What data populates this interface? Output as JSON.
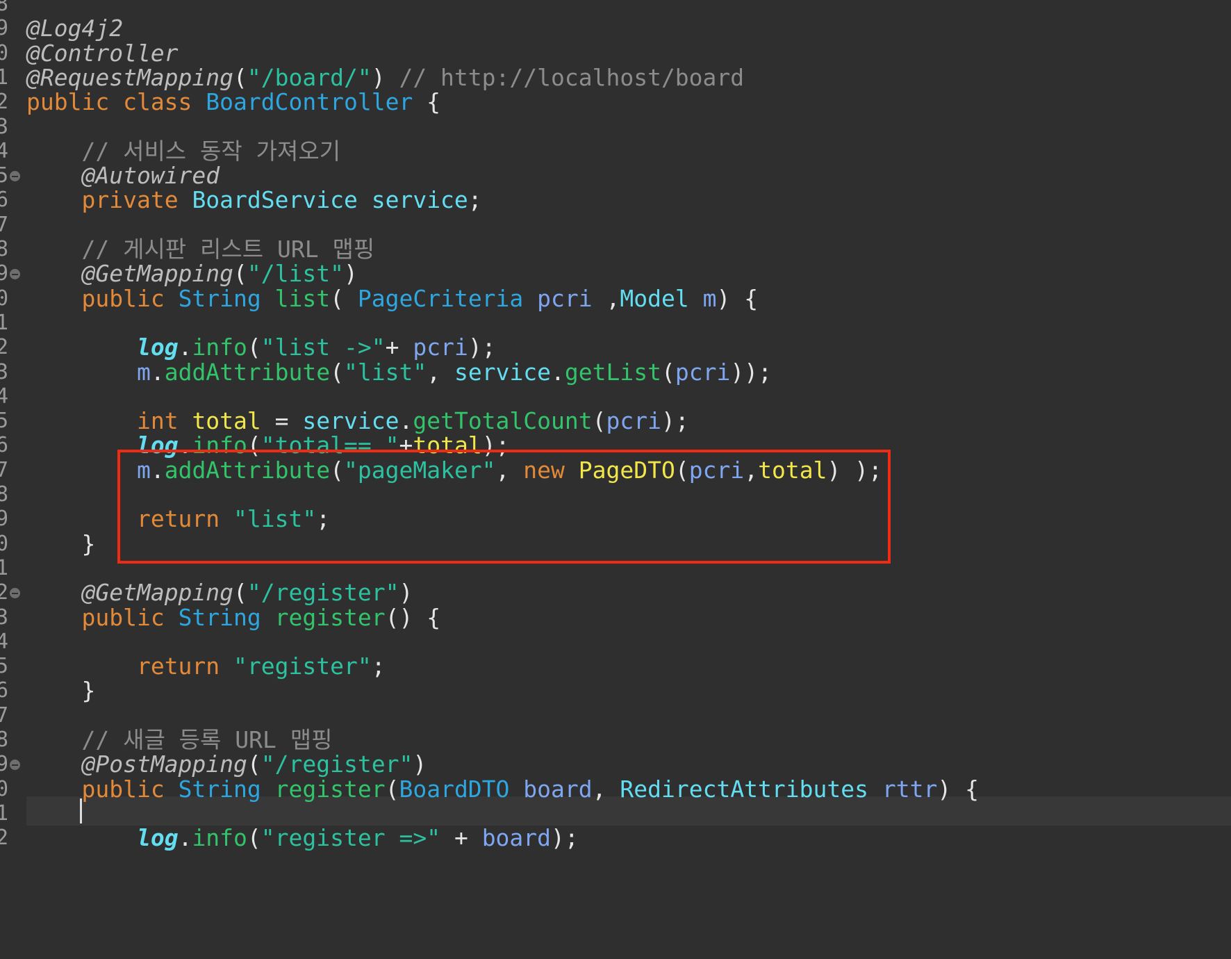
{
  "colors": {
    "background": "#2f2f2f",
    "annotation": "#bdbdbd",
    "keyword": "#e28a3a",
    "type": "#2ea6df",
    "string": "#2cc2a0",
    "comment": "#8c8c8c",
    "method": "#33c46b",
    "field": "#63ddf0",
    "local": "#f1e64a",
    "param": "#7fa6f0",
    "plain": "#e6e6e6",
    "highlight_box": "#ef2b13"
  },
  "editor": {
    "lines": [
      {
        "num": "8",
        "fold": false,
        "tokens": []
      },
      {
        "num": "9",
        "fold": false,
        "tokens": [
          {
            "t": "@Log4j2",
            "c": "ann"
          }
        ]
      },
      {
        "num": "0",
        "fold": false,
        "tokens": [
          {
            "t": "@Controller",
            "c": "ann"
          }
        ]
      },
      {
        "num": "1",
        "fold": false,
        "tokens": [
          {
            "t": "@RequestMapping",
            "c": "ann"
          },
          {
            "t": "(",
            "c": "plain"
          },
          {
            "t": "\"/board/\"",
            "c": "str"
          },
          {
            "t": ") ",
            "c": "plain"
          },
          {
            "t": "// http://localhost/board",
            "c": "comment"
          }
        ]
      },
      {
        "num": "2",
        "fold": false,
        "tokens": [
          {
            "t": "public ",
            "c": "kw"
          },
          {
            "t": "class ",
            "c": "kw"
          },
          {
            "t": "BoardController",
            "c": "type"
          },
          {
            "t": " {",
            "c": "plain"
          }
        ]
      },
      {
        "num": "3",
        "fold": false,
        "tokens": []
      },
      {
        "num": "4",
        "fold": false,
        "tokens": [
          {
            "t": "    ",
            "c": "plain"
          },
          {
            "t": "// 서비스 동작 가져오기",
            "c": "comment"
          }
        ]
      },
      {
        "num": "5",
        "fold": true,
        "tokens": [
          {
            "t": "    ",
            "c": "plain"
          },
          {
            "t": "@Autowired",
            "c": "ann"
          }
        ]
      },
      {
        "num": "6",
        "fold": false,
        "tokens": [
          {
            "t": "    ",
            "c": "plain"
          },
          {
            "t": "private ",
            "c": "kw"
          },
          {
            "t": "BoardService ",
            "c": "field"
          },
          {
            "t": "service",
            "c": "field"
          },
          {
            "t": ";",
            "c": "plain"
          }
        ]
      },
      {
        "num": "7",
        "fold": false,
        "tokens": []
      },
      {
        "num": "8",
        "fold": false,
        "tokens": [
          {
            "t": "    ",
            "c": "plain"
          },
          {
            "t": "// 게시판 리스트 URL 맵핑",
            "c": "comment"
          }
        ]
      },
      {
        "num": "9",
        "fold": true,
        "tokens": [
          {
            "t": "    ",
            "c": "plain"
          },
          {
            "t": "@GetMapping",
            "c": "ann"
          },
          {
            "t": "(",
            "c": "plain"
          },
          {
            "t": "\"/list\"",
            "c": "str"
          },
          {
            "t": ")",
            "c": "plain"
          }
        ]
      },
      {
        "num": "0",
        "fold": false,
        "tokens": [
          {
            "t": "    ",
            "c": "plain"
          },
          {
            "t": "public ",
            "c": "kw"
          },
          {
            "t": "String ",
            "c": "type"
          },
          {
            "t": "list",
            "c": "method"
          },
          {
            "t": "( ",
            "c": "plain"
          },
          {
            "t": "PageCriteria ",
            "c": "type"
          },
          {
            "t": "pcri",
            "c": "param"
          },
          {
            "t": " ,",
            "c": "plain"
          },
          {
            "t": "Model ",
            "c": "field"
          },
          {
            "t": "m",
            "c": "param"
          },
          {
            "t": ") {",
            "c": "plain"
          }
        ]
      },
      {
        "num": "1",
        "fold": false,
        "tokens": []
      },
      {
        "num": "2",
        "fold": false,
        "tokens": [
          {
            "t": "        ",
            "c": "plain"
          },
          {
            "t": "log",
            "c": "logf"
          },
          {
            "t": ".",
            "c": "plain"
          },
          {
            "t": "info",
            "c": "method"
          },
          {
            "t": "(",
            "c": "plain"
          },
          {
            "t": "\"list ->\"",
            "c": "str"
          },
          {
            "t": "+ ",
            "c": "plain"
          },
          {
            "t": "pcri",
            "c": "param"
          },
          {
            "t": ");",
            "c": "plain"
          }
        ]
      },
      {
        "num": "3",
        "fold": false,
        "tokens": [
          {
            "t": "        ",
            "c": "plain"
          },
          {
            "t": "m",
            "c": "param"
          },
          {
            "t": ".",
            "c": "plain"
          },
          {
            "t": "addAttribute",
            "c": "method"
          },
          {
            "t": "(",
            "c": "plain"
          },
          {
            "t": "\"list\"",
            "c": "str"
          },
          {
            "t": ", ",
            "c": "plain"
          },
          {
            "t": "service",
            "c": "field"
          },
          {
            "t": ".",
            "c": "plain"
          },
          {
            "t": "getList",
            "c": "method"
          },
          {
            "t": "(",
            "c": "plain"
          },
          {
            "t": "pcri",
            "c": "param"
          },
          {
            "t": "));",
            "c": "plain"
          }
        ]
      },
      {
        "num": "4",
        "fold": false,
        "tokens": []
      },
      {
        "num": "5",
        "fold": false,
        "tokens": [
          {
            "t": "        ",
            "c": "plain"
          },
          {
            "t": "int ",
            "c": "kw"
          },
          {
            "t": "total",
            "c": "local"
          },
          {
            "t": " = ",
            "c": "plain"
          },
          {
            "t": "service",
            "c": "field"
          },
          {
            "t": ".",
            "c": "plain"
          },
          {
            "t": "getTotalCount",
            "c": "method"
          },
          {
            "t": "(",
            "c": "plain"
          },
          {
            "t": "pcri",
            "c": "param"
          },
          {
            "t": ");",
            "c": "plain"
          }
        ]
      },
      {
        "num": "6",
        "fold": false,
        "tokens": [
          {
            "t": "        ",
            "c": "plain"
          },
          {
            "t": "log",
            "c": "logf"
          },
          {
            "t": ".",
            "c": "plain"
          },
          {
            "t": "info",
            "c": "method"
          },
          {
            "t": "(",
            "c": "plain"
          },
          {
            "t": "\"total== \"",
            "c": "str"
          },
          {
            "t": "+",
            "c": "plain"
          },
          {
            "t": "total",
            "c": "local"
          },
          {
            "t": ");",
            "c": "plain"
          }
        ]
      },
      {
        "num": "7",
        "fold": false,
        "tokens": [
          {
            "t": "        ",
            "c": "plain"
          },
          {
            "t": "m",
            "c": "param"
          },
          {
            "t": ".",
            "c": "plain"
          },
          {
            "t": "addAttribute",
            "c": "method"
          },
          {
            "t": "(",
            "c": "plain"
          },
          {
            "t": "\"pageMaker\"",
            "c": "str"
          },
          {
            "t": ", ",
            "c": "plain"
          },
          {
            "t": "new ",
            "c": "kw"
          },
          {
            "t": "PageDTO",
            "c": "ctor"
          },
          {
            "t": "(",
            "c": "plain"
          },
          {
            "t": "pcri",
            "c": "param"
          },
          {
            "t": ",",
            "c": "plain"
          },
          {
            "t": "total",
            "c": "local"
          },
          {
            "t": ") );",
            "c": "plain"
          }
        ]
      },
      {
        "num": "8",
        "fold": false,
        "tokens": []
      },
      {
        "num": "9",
        "fold": false,
        "tokens": [
          {
            "t": "        ",
            "c": "plain"
          },
          {
            "t": "return ",
            "c": "kw"
          },
          {
            "t": "\"list\"",
            "c": "str"
          },
          {
            "t": ";",
            "c": "plain"
          }
        ]
      },
      {
        "num": "0",
        "fold": false,
        "tokens": [
          {
            "t": "    }",
            "c": "plain"
          }
        ]
      },
      {
        "num": "1",
        "fold": false,
        "tokens": []
      },
      {
        "num": "2",
        "fold": true,
        "tokens": [
          {
            "t": "    ",
            "c": "plain"
          },
          {
            "t": "@GetMapping",
            "c": "ann"
          },
          {
            "t": "(",
            "c": "plain"
          },
          {
            "t": "\"/register\"",
            "c": "str"
          },
          {
            "t": ")",
            "c": "plain"
          }
        ]
      },
      {
        "num": "3",
        "fold": false,
        "tokens": [
          {
            "t": "    ",
            "c": "plain"
          },
          {
            "t": "public ",
            "c": "kw"
          },
          {
            "t": "String ",
            "c": "type"
          },
          {
            "t": "register",
            "c": "method"
          },
          {
            "t": "() {",
            "c": "plain"
          }
        ]
      },
      {
        "num": "4",
        "fold": false,
        "tokens": []
      },
      {
        "num": "5",
        "fold": false,
        "tokens": [
          {
            "t": "        ",
            "c": "plain"
          },
          {
            "t": "return ",
            "c": "kw"
          },
          {
            "t": "\"register\"",
            "c": "str"
          },
          {
            "t": ";",
            "c": "plain"
          }
        ]
      },
      {
        "num": "6",
        "fold": false,
        "tokens": [
          {
            "t": "    }",
            "c": "plain"
          }
        ]
      },
      {
        "num": "7",
        "fold": false,
        "tokens": []
      },
      {
        "num": "8",
        "fold": false,
        "tokens": [
          {
            "t": "    ",
            "c": "plain"
          },
          {
            "t": "// 새글 등록 URL 맵핑",
            "c": "comment"
          }
        ]
      },
      {
        "num": "9",
        "fold": true,
        "tokens": [
          {
            "t": "    ",
            "c": "plain"
          },
          {
            "t": "@PostMapping",
            "c": "ann"
          },
          {
            "t": "(",
            "c": "plain"
          },
          {
            "t": "\"/register\"",
            "c": "str"
          },
          {
            "t": ")",
            "c": "plain"
          }
        ]
      },
      {
        "num": "0",
        "fold": false,
        "tokens": [
          {
            "t": "    ",
            "c": "plain"
          },
          {
            "t": "public ",
            "c": "kw"
          },
          {
            "t": "String ",
            "c": "type"
          },
          {
            "t": "register",
            "c": "method"
          },
          {
            "t": "(",
            "c": "plain"
          },
          {
            "t": "BoardDTO ",
            "c": "type"
          },
          {
            "t": "board",
            "c": "param"
          },
          {
            "t": ", ",
            "c": "plain"
          },
          {
            "t": "RedirectAttributes ",
            "c": "field"
          },
          {
            "t": "rttr",
            "c": "param"
          },
          {
            "t": ") {",
            "c": "plain"
          }
        ]
      },
      {
        "num": "1",
        "fold": false,
        "tokens": []
      },
      {
        "num": "2",
        "fold": false,
        "tokens": [
          {
            "t": "        ",
            "c": "plain"
          },
          {
            "t": "log",
            "c": "logf"
          },
          {
            "t": ".",
            "c": "plain"
          },
          {
            "t": "info",
            "c": "method"
          },
          {
            "t": "(",
            "c": "plain"
          },
          {
            "t": "\"register =>\"",
            "c": "str"
          },
          {
            "t": " + ",
            "c": "plain"
          },
          {
            "t": "board",
            "c": "param"
          },
          {
            "t": ");",
            "c": "plain"
          }
        ]
      }
    ]
  }
}
